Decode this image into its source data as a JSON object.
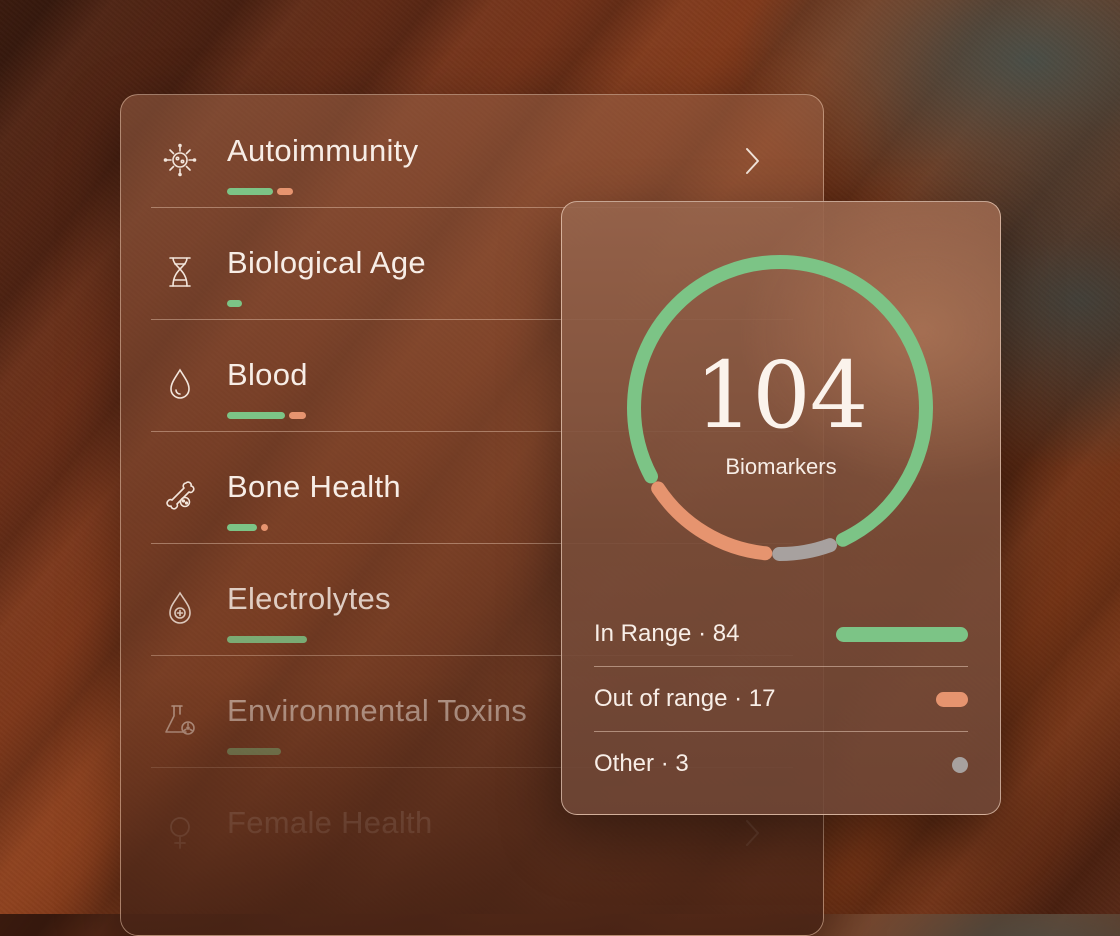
{
  "categories": [
    {
      "label": "Autoimmunity",
      "icon": "sun-virus-icon",
      "in_range": 3,
      "out_range": 1,
      "has_chevron": true
    },
    {
      "label": "Biological Age",
      "icon": "hourglass-dna-icon",
      "in_range": 1,
      "out_range": 0,
      "has_chevron": false
    },
    {
      "label": "Blood",
      "icon": "droplet-icon",
      "in_range": 4,
      "out_range": 1,
      "has_chevron": false
    },
    {
      "label": "Bone Health",
      "icon": "bone-icon",
      "in_range": 2,
      "out_range": 0.3,
      "has_chevron": false
    },
    {
      "label": "Electrolytes",
      "icon": "droplet-plus-icon",
      "in_range": 5,
      "out_range": 0,
      "has_chevron": false
    },
    {
      "label": "Environmental Toxins",
      "icon": "flask-hazard-icon",
      "in_range": 3.5,
      "out_range": 0,
      "has_chevron": false
    },
    {
      "label": "Female Health",
      "icon": "female-symbol-icon",
      "in_range": 0,
      "out_range": 0,
      "has_chevron": true
    }
  ],
  "summary": {
    "total": "104",
    "total_label": "Biomarkers",
    "legend": [
      {
        "label": "In Range · 84",
        "value": 84,
        "color": "#7cc486"
      },
      {
        "label": "Out of range · 17",
        "value": 17,
        "color": "#e6946f"
      },
      {
        "label": "Other · 3",
        "value": 3,
        "color": "#a7a19f"
      }
    ]
  },
  "colors": {
    "in_range": "#7cc486",
    "out_of_range": "#e6946f",
    "other": "#a7a19f"
  }
}
